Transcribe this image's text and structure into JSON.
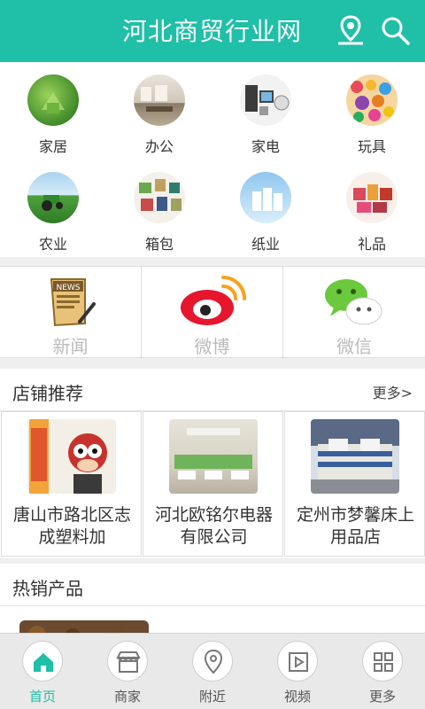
{
  "header": {
    "title": "河北商贸行业网"
  },
  "categories": [
    {
      "label": "家居",
      "icon": "home-furnishing-icon"
    },
    {
      "label": "办公",
      "icon": "office-icon"
    },
    {
      "label": "家电",
      "icon": "appliance-icon"
    },
    {
      "label": "玩具",
      "icon": "toy-icon"
    },
    {
      "label": "农业",
      "icon": "agriculture-icon"
    },
    {
      "label": "箱包",
      "icon": "luggage-icon"
    },
    {
      "label": "纸业",
      "icon": "paper-icon"
    },
    {
      "label": "礼品",
      "icon": "gift-icon"
    }
  ],
  "social": [
    {
      "label": "新闻",
      "icon": "news-icon"
    },
    {
      "label": "微博",
      "icon": "weibo-icon"
    },
    {
      "label": "微信",
      "icon": "wechat-icon"
    }
  ],
  "recommend": {
    "title": "店铺推荐",
    "more": "更多>",
    "shops": [
      {
        "name": "唐山市路北区志成塑料加"
      },
      {
        "name": "河北欧铭尔电器有限公司"
      },
      {
        "name": "定州市梦馨床上用品店"
      }
    ]
  },
  "hot": {
    "title": "热销产品"
  },
  "nav": [
    {
      "label": "首页",
      "icon": "home-icon",
      "active": true
    },
    {
      "label": "商家",
      "icon": "shop-icon",
      "active": false
    },
    {
      "label": "附近",
      "icon": "location-icon",
      "active": false
    },
    {
      "label": "视频",
      "icon": "video-icon",
      "active": false
    },
    {
      "label": "更多",
      "icon": "grid-icon",
      "active": false
    }
  ],
  "colors": {
    "accent": "#1fbfa8",
    "weibo": "#e6162d",
    "wechat": "#6ac93c"
  }
}
